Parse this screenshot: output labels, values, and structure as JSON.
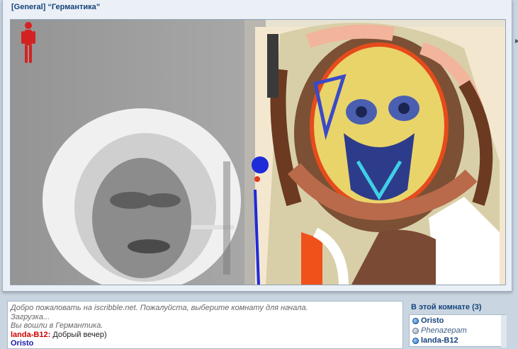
{
  "window": {
    "title": "[General] “Германтика”"
  },
  "chat": {
    "messages": [
      {
        "type": "system",
        "text": "Добро пожаловать на iscribble.net. Пожалуйста, выберите комнату для начала."
      },
      {
        "type": "system",
        "text": "Загрузка..."
      },
      {
        "type": "system",
        "text": "Вы вошли в Германтика."
      },
      {
        "type": "user",
        "nick": "landa-B12:",
        "text": "Добрый вечер)"
      },
      {
        "type": "user2",
        "nick": "Oristo",
        "text": ""
      }
    ]
  },
  "room": {
    "title": "В этой комнате (3)",
    "users": [
      {
        "name": "Oristo",
        "status": "active"
      },
      {
        "name": "Phenazepam",
        "status": "idle"
      },
      {
        "name": "landa-B12",
        "status": "active"
      }
    ]
  },
  "colors": {
    "accent": "#15437a",
    "nick_red": "#d10000",
    "background": "#c9d6e2"
  },
  "icons": {
    "avatar": "red-figure-icon",
    "online": "online-dot-icon",
    "scroll": "chevron-right-icon"
  }
}
